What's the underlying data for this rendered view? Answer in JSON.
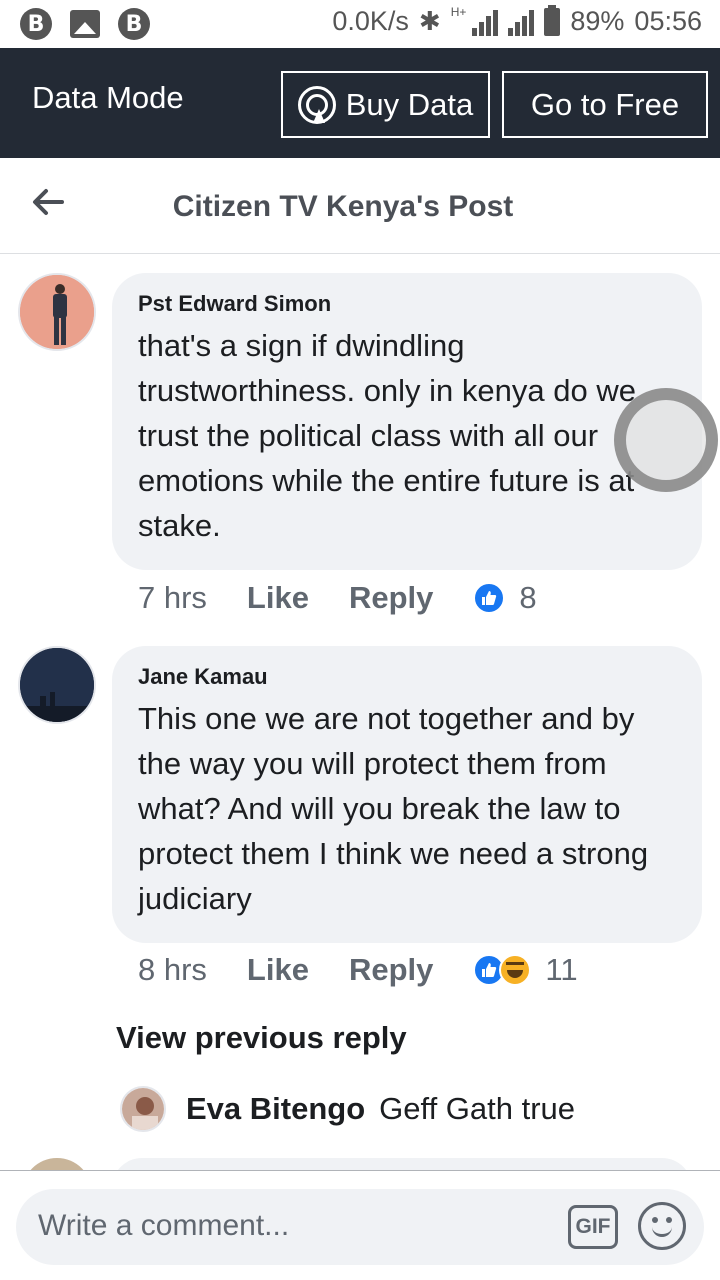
{
  "status_bar": {
    "left_icons": [
      "b-app-icon",
      "image-icon",
      "b-app-icon"
    ],
    "speed": "0.0K/s",
    "network": "H+",
    "battery": "89%",
    "time": "05:56"
  },
  "data_bar": {
    "label": "Data Mode",
    "buy_label": "Buy Data",
    "free_label": "Go to Free"
  },
  "header": {
    "title": "Citizen TV Kenya's Post"
  },
  "comments": [
    {
      "author": "Pst Edward Simon",
      "text": "that's  a sign if dwindling trustworthiness. only in kenya do we trust the political class with all our emotions while the entire future is at stake.",
      "time": "7 hrs",
      "like": "Like",
      "reply": "Reply",
      "reactions": [
        "like"
      ],
      "count": "8"
    },
    {
      "author": "Jane Kamau",
      "text": "This one we are not together and by the way you will protect them from what? And will you break the law to protect them I think we need a strong judiciary",
      "time": "8 hrs",
      "like": "Like",
      "reply": "Reply",
      "reactions": [
        "like",
        "haha"
      ],
      "count": "11"
    }
  ],
  "view_previous": "View previous reply",
  "reply": {
    "author": "Eva Bitengo",
    "text": "Geff Gath true"
  },
  "composer": {
    "placeholder": "Write a comment...",
    "gif_label": "GIF"
  },
  "colors": {
    "data_bar_bg": "#232a35",
    "bubble_bg": "#f0f2f5",
    "like_blue": "#1877f2",
    "haha_yellow": "#f7b125"
  }
}
